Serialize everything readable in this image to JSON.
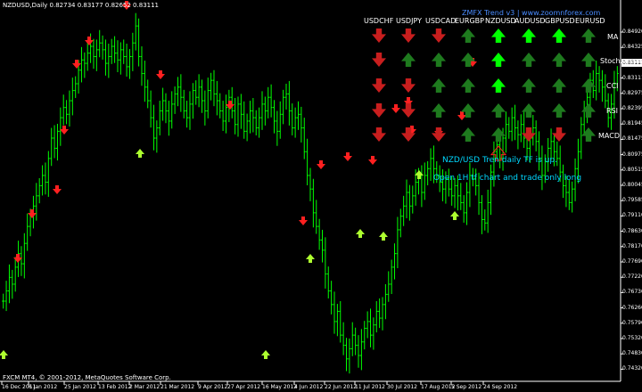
{
  "chart_header": {
    "symbol_info": "NZDUSD,Daily  0.82734 0.83177 0.82652 0.83111"
  },
  "trend_panel": {
    "title": "ZMFX Trend v3 | www.zoomnforex.com",
    "currencies": [
      "USDCHF",
      "USDJPY",
      "USDCAD",
      "EURGBP",
      "NZDUSD",
      "AUDUSD",
      "GBPUSD",
      "EURUSD"
    ],
    "indicators": [
      "MA",
      "Stoch",
      "CCI",
      "RSI",
      "MACD"
    ],
    "signals": [
      [
        "down-red",
        "down-red",
        "down-red",
        "up-darkgreen",
        "up-brightgreen",
        "up-brightgreen",
        "up-brightgreen",
        "up-darkgreen"
      ],
      [
        "down-red",
        "up-darkgreen",
        "up-darkgreen",
        "up-darkgreen",
        "up-brightgreen",
        "up-darkgreen",
        "up-darkgreen",
        "up-darkgreen"
      ],
      [
        "down-red",
        "down-red",
        "up-darkgreen",
        "up-darkgreen",
        "up-brightgreen",
        "up-darkgreen",
        "up-darkgreen",
        "up-darkgreen"
      ],
      [
        "down-red",
        "down-red",
        "up-darkgreen",
        "up-darkgreen",
        "up-darkgreen",
        "up-darkgreen",
        "up-darkgreen",
        "up-darkgreen"
      ],
      [
        "down-red",
        "down-red",
        "down-red",
        "up-darkgreen",
        "up-darkgreen",
        "down-red",
        "down-red",
        "up-darkgreen"
      ]
    ],
    "extra_arrow": "up-outline-red",
    "message_line1": "NZD/USD Tren daily TF is up.",
    "message_line2": "Open 1H tf chart and trade only long"
  },
  "y_axis": {
    "labels": [
      "0.84920",
      "0.84325",
      "0.83743",
      "0.83111",
      "0.82975",
      "0.82395",
      "0.81945",
      "0.81475",
      "0.80975",
      "0.80515",
      "0.80045",
      "0.79585",
      "0.79110",
      "0.78630",
      "0.78170",
      "0.77690",
      "0.77220",
      "0.76730",
      "0.76260",
      "0.75790",
      "0.75320",
      "0.74830",
      "0.74320"
    ],
    "current_price": "0.83111"
  },
  "x_axis": {
    "labels": [
      "16 Dec 2011",
      "6 Jan 2012",
      "25 Jan 2012",
      "13 Feb 2012",
      "2 Mar 2012",
      "21 Mar 2012",
      "9 Apr 2012",
      "27 Apr 2012",
      "16 May 2012",
      "4 Jun 2012",
      "22 Jun 2012",
      "11 Jul 2012",
      "30 Jul 2012",
      "17 Aug 2012",
      "5 Sep 2012",
      "24 Sep 2012"
    ]
  },
  "footer": {
    "copyright": "FXCM MT4, © 2001-2012, MetaQuotes Software Corp."
  },
  "colors": {
    "candle": "#00ff00",
    "down_arrow": "#ff2020",
    "up_arrow_chart": "#adff2f",
    "signal_red": "#c81e1e",
    "signal_dark_green": "#1e7a1e",
    "signal_bright_green": "#00ff00",
    "message": "#00d8ff",
    "title": "#4a8cff"
  },
  "chart_data": {
    "type": "ohlc",
    "title": "NZDUSD,Daily",
    "ylim": [
      0.7425,
      0.8495
    ],
    "series": [
      {
        "name": "NZDUSD",
        "close": [
          0.764,
          0.767,
          0.771,
          0.769,
          0.774,
          0.778,
          0.775,
          0.781,
          0.786,
          0.789,
          0.792,
          0.795,
          0.798,
          0.801,
          0.799,
          0.806,
          0.812,
          0.809,
          0.814,
          0.818,
          0.821,
          0.819,
          0.823,
          0.826,
          0.828,
          0.832,
          0.835,
          0.834,
          0.837,
          0.839,
          0.836,
          0.838,
          0.84,
          0.838,
          0.834,
          0.836,
          0.839,
          0.837,
          0.835,
          0.838,
          0.836,
          0.833,
          0.836,
          0.84,
          0.845,
          0.836,
          0.831,
          0.827,
          0.823,
          0.818,
          0.812,
          0.815,
          0.82,
          0.823,
          0.82,
          0.817,
          0.822,
          0.825,
          0.827,
          0.824,
          0.82,
          0.818,
          0.822,
          0.826,
          0.824,
          0.827,
          0.823,
          0.82,
          0.826,
          0.829,
          0.825,
          0.823,
          0.82,
          0.817,
          0.821,
          0.824,
          0.82,
          0.816,
          0.822,
          0.819,
          0.814,
          0.817,
          0.82,
          0.818,
          0.815,
          0.818,
          0.822,
          0.82,
          0.824,
          0.821,
          0.817,
          0.814,
          0.819,
          0.824,
          0.825,
          0.82,
          0.815,
          0.818,
          0.819,
          0.815,
          0.808,
          0.801,
          0.797,
          0.79,
          0.786,
          0.782,
          0.779,
          0.772,
          0.767,
          0.763,
          0.758,
          0.761,
          0.754,
          0.751,
          0.747,
          0.75,
          0.754,
          0.751,
          0.748,
          0.752,
          0.756,
          0.758,
          0.754,
          0.757,
          0.761,
          0.759,
          0.763,
          0.766,
          0.769,
          0.774,
          0.778,
          0.785,
          0.789,
          0.792,
          0.796,
          0.792,
          0.795,
          0.799,
          0.801,
          0.796,
          0.801,
          0.803,
          0.806,
          0.803,
          0.801,
          0.799,
          0.797,
          0.8,
          0.797,
          0.795,
          0.798,
          0.795,
          0.793,
          0.79,
          0.796,
          0.801,
          0.8,
          0.798,
          0.793,
          0.788,
          0.787,
          0.793,
          0.802,
          0.808,
          0.81,
          0.806,
          0.812,
          0.816,
          0.814,
          0.818,
          0.815,
          0.813,
          0.816,
          0.812,
          0.809,
          0.812,
          0.815,
          0.811,
          0.806,
          0.801,
          0.805,
          0.809,
          0.811,
          0.808,
          0.806,
          0.802,
          0.798,
          0.796,
          0.793,
          0.797,
          0.803,
          0.808,
          0.816,
          0.82,
          0.824,
          0.829,
          0.826,
          0.831,
          0.829,
          0.827,
          0.823,
          0.818,
          0.822,
          0.828,
          0.831
        ]
      }
    ],
    "x_labels": [
      "16 Dec 2011",
      "6 Jan 2012",
      "25 Jan 2012",
      "13 Feb 2012",
      "2 Mar 2012",
      "21 Mar 2012",
      "9 Apr 2012",
      "27 Apr 2012",
      "16 May 2012",
      "4 Jun 2012",
      "22 Jun 2012",
      "11 Jul 2012",
      "30 Jul 2012",
      "17 Aug 2012",
      "5 Sep 2012",
      "24 Sep 2012"
    ]
  }
}
